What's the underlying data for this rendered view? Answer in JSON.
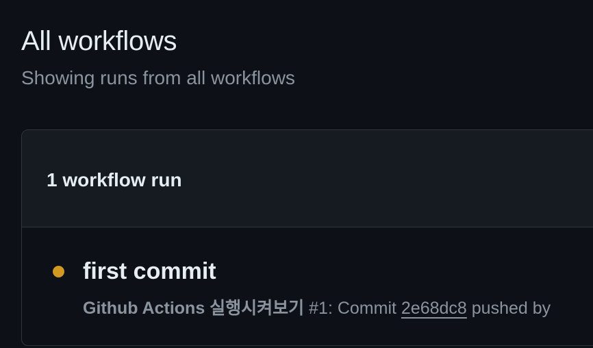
{
  "header": {
    "title": "All workflows",
    "subtitle": "Showing runs from all workflows"
  },
  "runs": {
    "count_label": "1 workflow run",
    "items": [
      {
        "title": "first commit",
        "workflow_name": "Github Actions 실행시켜보기",
        "run_number": "#1",
        "event_prefix": ": Commit",
        "commit_sha": "2e68dc8",
        "event_suffix": "pushed by",
        "status": "in-progress",
        "status_color": "#d29922"
      }
    ]
  }
}
